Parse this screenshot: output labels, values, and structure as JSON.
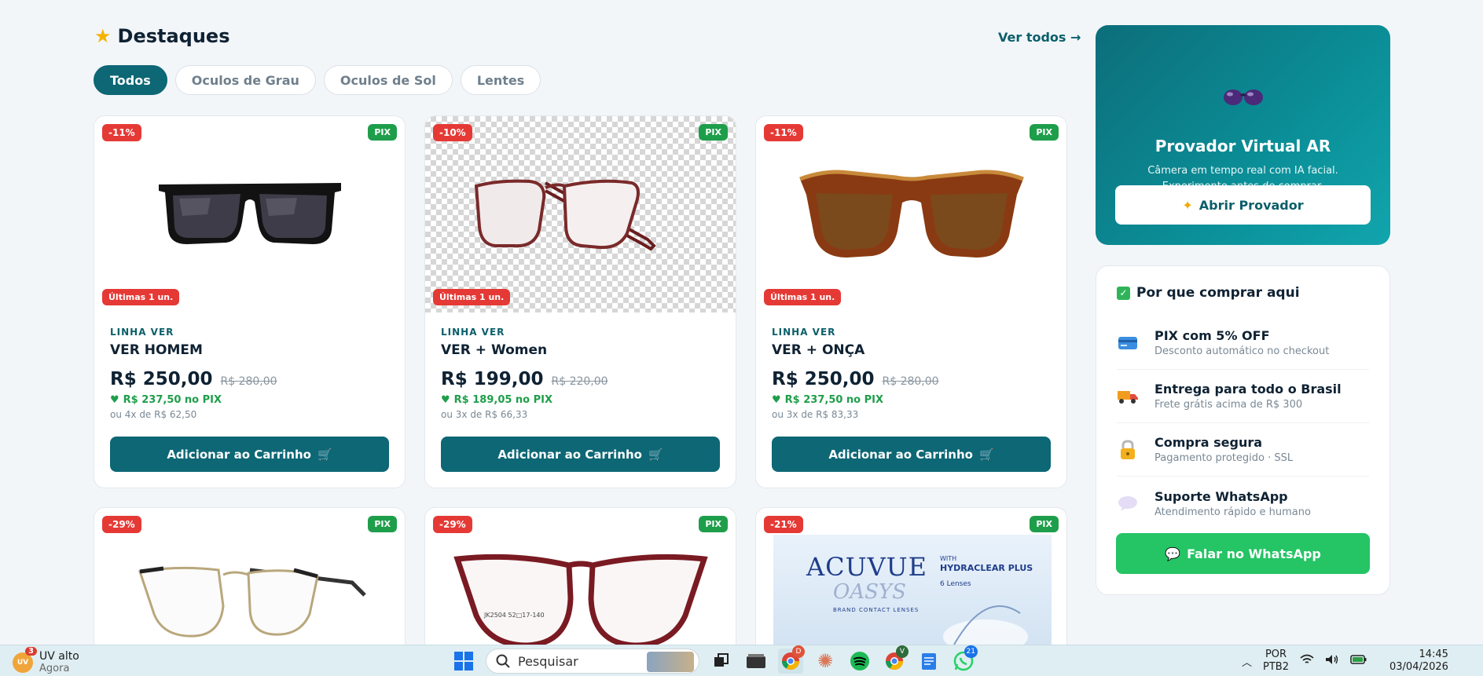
{
  "section": {
    "title": "Destaques",
    "see_all": "Ver todos →"
  },
  "filters": [
    "Todos",
    "Oculos de Grau",
    "Oculos de Sol",
    "Lentes"
  ],
  "products": [
    {
      "discount": "-11%",
      "pix_badge": "PIX",
      "stock": "Últimas 1 un.",
      "brand": "LINHA VER",
      "name": "VER HOMEM",
      "price": "R$ 250,00",
      "old_price": "R$ 280,00",
      "pix_price": "R$ 237,50 no PIX",
      "installments": "ou 4x de R$ 62,50",
      "button": "Adicionar ao Carrinho",
      "image": "black-sunglasses"
    },
    {
      "discount": "-10%",
      "pix_badge": "PIX",
      "stock": "Últimas 1 un.",
      "brand": "LINHA VER",
      "name": "VER + Women",
      "price": "R$ 199,00",
      "old_price": "R$ 220,00",
      "pix_price": "R$ 189,05 no PIX",
      "installments": "ou 3x de R$ 66,33",
      "button": "Adicionar ao Carrinho",
      "image": "clear-frame-glasses"
    },
    {
      "discount": "-11%",
      "pix_badge": "PIX",
      "stock": "Últimas 1 un.",
      "brand": "LINHA VER",
      "name": "VER + ONÇA",
      "price": "R$ 250,00",
      "old_price": "R$ 280,00",
      "pix_price": "R$ 237,50 no PIX",
      "installments": "ou 3x de R$ 83,33",
      "button": "Adicionar ao Carrinho",
      "image": "tortoise-sunglasses"
    },
    {
      "discount": "-29%",
      "pix_badge": "PIX",
      "image": "gold-cateye-glasses"
    },
    {
      "discount": "-29%",
      "pix_badge": "PIX",
      "image": "red-cateye-glasses",
      "frame_text": "JK2504 52□17-140"
    },
    {
      "discount": "-21%",
      "pix_badge": "PIX",
      "image": "acuvue-box",
      "box": {
        "brand": "ACUVUE",
        "sub": "OASYS",
        "with": "WITH",
        "tech": "HYDRACLEAR PLUS",
        "lenses": "6 Lenses",
        "line": "BRAND CONTACT LENSES"
      }
    }
  ],
  "ar_panel": {
    "title": "Provador Virtual AR",
    "description": "Câmera em tempo real com IA facial. Experimente antes de comprar.",
    "button": "Abrir Provador"
  },
  "why_panel": {
    "title": "Por que comprar aqui",
    "items": [
      {
        "title": "PIX com 5% OFF",
        "subtitle": "Desconto automático no checkout",
        "icon": "card-icon"
      },
      {
        "title": "Entrega para todo o Brasil",
        "subtitle": "Frete grátis acima de R$ 300",
        "icon": "truck-icon"
      },
      {
        "title": "Compra segura",
        "subtitle": "Pagamento protegido · SSL",
        "icon": "lock-icon"
      },
      {
        "title": "Suporte WhatsApp",
        "subtitle": "Atendimento rápido e humano",
        "icon": "chat-bubble-icon"
      }
    ],
    "whatsapp_button": "Falar no WhatsApp"
  },
  "taskbar": {
    "weather_badge": "UV",
    "weather_count": "3",
    "weather_title": "UV alto",
    "weather_sub": "Agora",
    "search_placeholder": "Pesquisar",
    "chrome_badge": "D",
    "chrome2_badge": "V",
    "whatsapp_badge": "21",
    "lang_top": "POR",
    "lang_bottom": "PTB2",
    "time": "14:45",
    "date": "03/04/2026"
  },
  "colors": {
    "primary": "#0d6775",
    "accent_green": "#1e9e4a",
    "discount_red": "#e53935",
    "whatsapp": "#25c465"
  }
}
